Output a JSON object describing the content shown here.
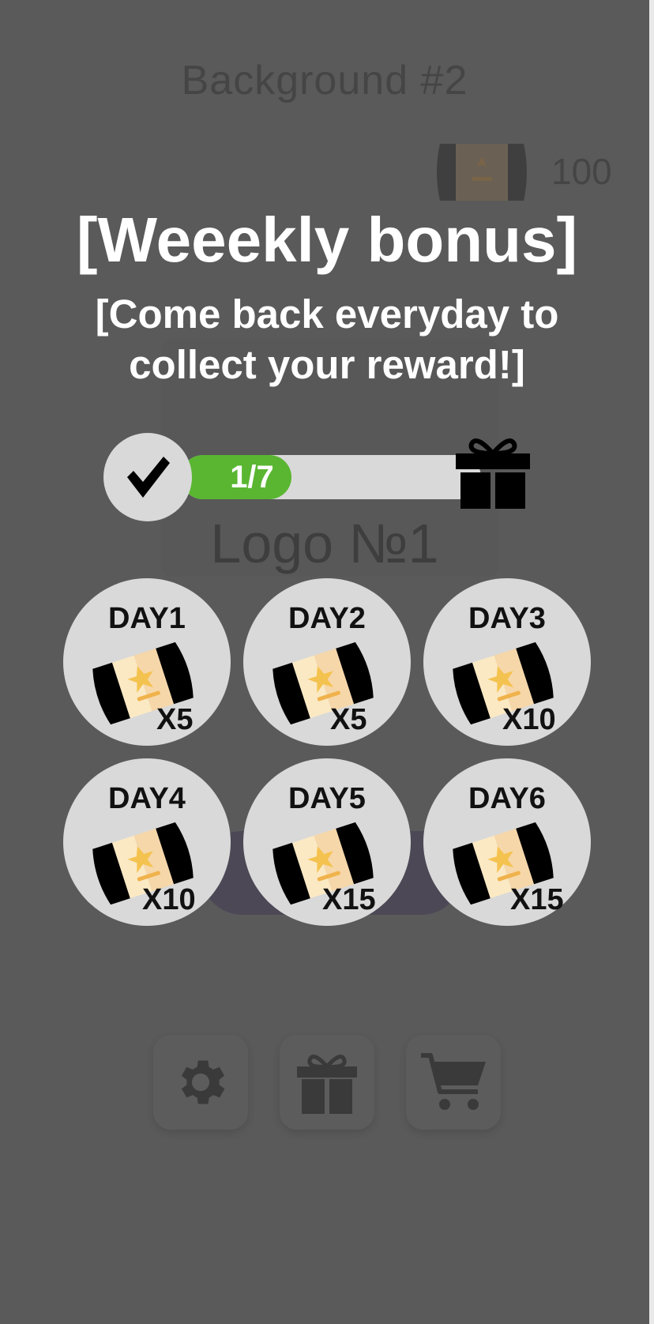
{
  "background_screen": {
    "title": "Background #2",
    "coins": "100",
    "logo": "Logo №1",
    "icons": [
      "gear-icon",
      "gift-icon",
      "cart-icon"
    ]
  },
  "weekly_bonus": {
    "title": "[Weeekly bonus]",
    "subtitle_line1": "[Come back everyday to",
    "subtitle_line2": "collect your reward!]",
    "progress": {
      "current": 1,
      "total": 7,
      "label": "1/7"
    },
    "days": [
      {
        "label": "DAY1",
        "qty": "X5"
      },
      {
        "label": "DAY2",
        "qty": "X5"
      },
      {
        "label": "DAY3",
        "qty": "X10"
      },
      {
        "label": "DAY4",
        "qty": "X10"
      },
      {
        "label": "DAY5",
        "qty": "X15"
      },
      {
        "label": "DAY6",
        "qty": "X15"
      }
    ]
  },
  "colors": {
    "overlay_bg": "#5a5a5a",
    "progress_fill": "#5ab631",
    "circle_bg": "#d9d9d9"
  }
}
